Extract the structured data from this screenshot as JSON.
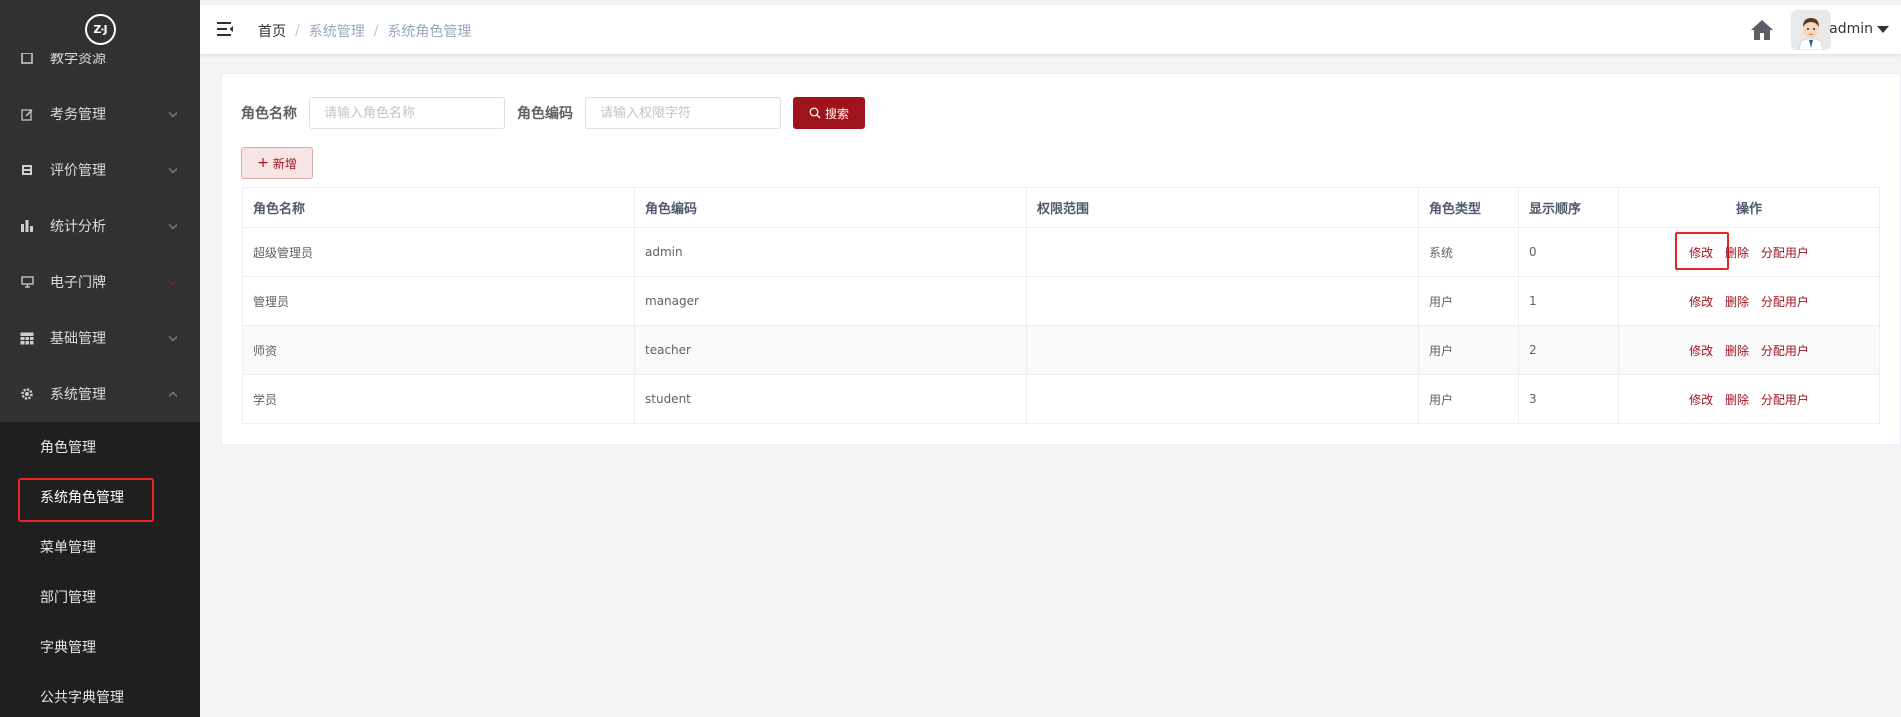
{
  "logo": {
    "text": "Z·J"
  },
  "sidebar": {
    "items": [
      {
        "label": "教学资源",
        "icon": "resource-icon"
      },
      {
        "label": "考务管理",
        "icon": "edit-icon"
      },
      {
        "label": "评价管理",
        "icon": "evaluation-icon"
      },
      {
        "label": "统计分析",
        "icon": "bar-chart-icon"
      },
      {
        "label": "电子门牌",
        "icon": "monitor-icon"
      },
      {
        "label": "基础管理",
        "icon": "grid-icon"
      },
      {
        "label": "系统管理",
        "icon": "gear-icon"
      }
    ],
    "subitems": [
      {
        "label": "角色管理"
      },
      {
        "label": "系统角色管理"
      },
      {
        "label": "菜单管理"
      },
      {
        "label": "部门管理"
      },
      {
        "label": "字典管理"
      },
      {
        "label": "公共字典管理"
      }
    ]
  },
  "header": {
    "breadcrumb": [
      "首页",
      "系统管理",
      "系统角色管理"
    ],
    "user": "admin"
  },
  "search": {
    "role_name_label": "角色名称",
    "role_name_placeholder": "请输入角色名称",
    "role_code_label": "角色编码",
    "role_code_placeholder": "请输入权限字符",
    "search_label": "搜索",
    "add_label": "新增"
  },
  "table": {
    "headers": [
      "角色名称",
      "角色编码",
      "权限范围",
      "角色类型",
      "显示顺序",
      "操作"
    ],
    "rows": [
      {
        "name": "超级管理员",
        "code": "admin",
        "scope": "",
        "type": "系统",
        "order": "0"
      },
      {
        "name": "管理员",
        "code": "manager",
        "scope": "",
        "type": "用户",
        "order": "1"
      },
      {
        "name": "师资",
        "code": "teacher",
        "scope": "",
        "type": "用户",
        "order": "2"
      },
      {
        "name": "学员",
        "code": "student",
        "scope": "",
        "type": "用户",
        "order": "3"
      }
    ],
    "actions": {
      "edit": "修改",
      "delete": "删除",
      "assign": "分配用户"
    }
  },
  "colors": {
    "accent": "#a0131d",
    "sidebar_bg": "#303133",
    "highlight": "#e82424"
  }
}
